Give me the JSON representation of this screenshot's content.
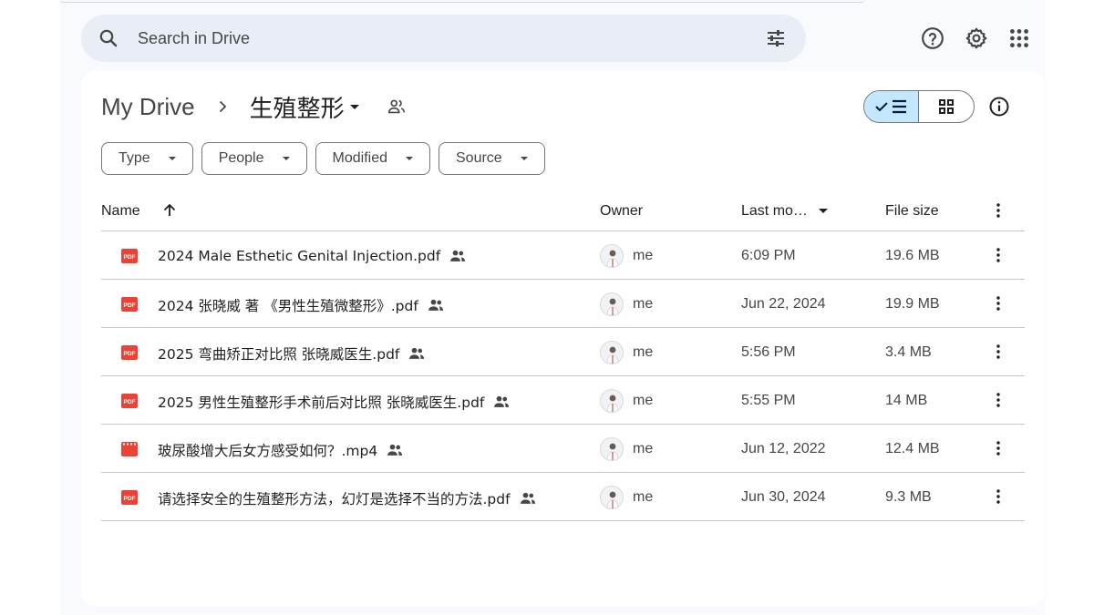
{
  "search": {
    "placeholder": "Search in Drive"
  },
  "toolbar_icons": [
    "help-icon",
    "settings-icon",
    "apps-icon"
  ],
  "breadcrumb": {
    "root": "My Drive",
    "current": "生殖整形"
  },
  "filters": [
    {
      "label": "Type"
    },
    {
      "label": "People"
    },
    {
      "label": "Modified"
    },
    {
      "label": "Source"
    }
  ],
  "table": {
    "headers": {
      "name": "Name",
      "owner": "Owner",
      "modified": "Last mo…",
      "size": "File size"
    },
    "rows": [
      {
        "type": "pdf",
        "name": "2024 Male Esthetic Genital Injection.pdf",
        "owner": "me",
        "modified": "6:09 PM",
        "size": "19.6 MB"
      },
      {
        "type": "pdf",
        "name": "2024 张晓威 著 《男性生殖微整形》.pdf",
        "owner": "me",
        "modified": "Jun 22, 2024",
        "size": "19.9 MB"
      },
      {
        "type": "pdf",
        "name": "2025 弯曲矫正对比照 张晓威医生.pdf",
        "owner": "me",
        "modified": "5:56 PM",
        "size": "3.4 MB"
      },
      {
        "type": "pdf",
        "name": "2025 男性生殖整形手术前后对比照 张晓威医生.pdf",
        "owner": "me",
        "modified": "5:55 PM",
        "size": "14 MB"
      },
      {
        "type": "video",
        "name": "玻尿酸增大后女方感受如何？.mp4",
        "owner": "me",
        "modified": "Jun 12, 2022",
        "size": "12.4 MB"
      },
      {
        "type": "pdf",
        "name": "请选择安全的生殖整形方法，幻灯是选择不当的方法.pdf",
        "owner": "me",
        "modified": "Jun 30, 2024",
        "size": "9.3 MB"
      }
    ]
  },
  "colors": {
    "accent": "#c2e7ff",
    "pdf_red": "#ea4335",
    "search_bg": "#e9eef6",
    "frame_bg": "#f8fafd"
  }
}
